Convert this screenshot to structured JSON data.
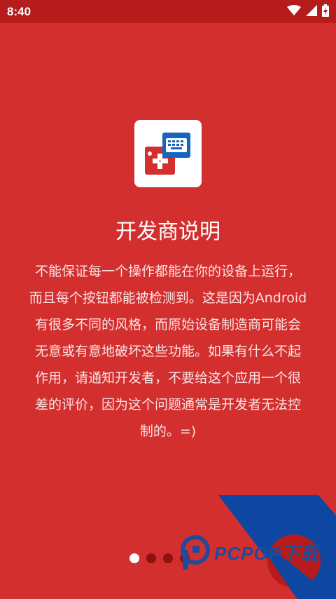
{
  "status_bar": {
    "time": "8:40",
    "icons": [
      "wifi-icon",
      "signal-icon",
      "battery-charging-icon"
    ]
  },
  "app_icon": "gamepad-keyboard-icon",
  "title": "开发商说明",
  "description_lines": [
    "不能保证每一个操作都能在你的设备上运行，",
    "而且每个按钮都能被检测到。这是因为Android",
    "有很多不同的风格，而原始设备制造商可能会",
    "无意或有意地破坏这些功能。如果有什么不起",
    "作用，请通知开发者，不要给这个应用一个很",
    "差的评价，因为这个问题通常是开发者无法控",
    "制的。=)"
  ],
  "pager": {
    "total": 4,
    "active_index": 0
  },
  "watermark": {
    "text": "PCPOP下载"
  },
  "colors": {
    "background": "#d32f2f",
    "status_bar": "#b71c1c",
    "accent_blue": "#0d47a1",
    "dot_inactive": "#8e1111",
    "dot_active": "#ffffff"
  }
}
